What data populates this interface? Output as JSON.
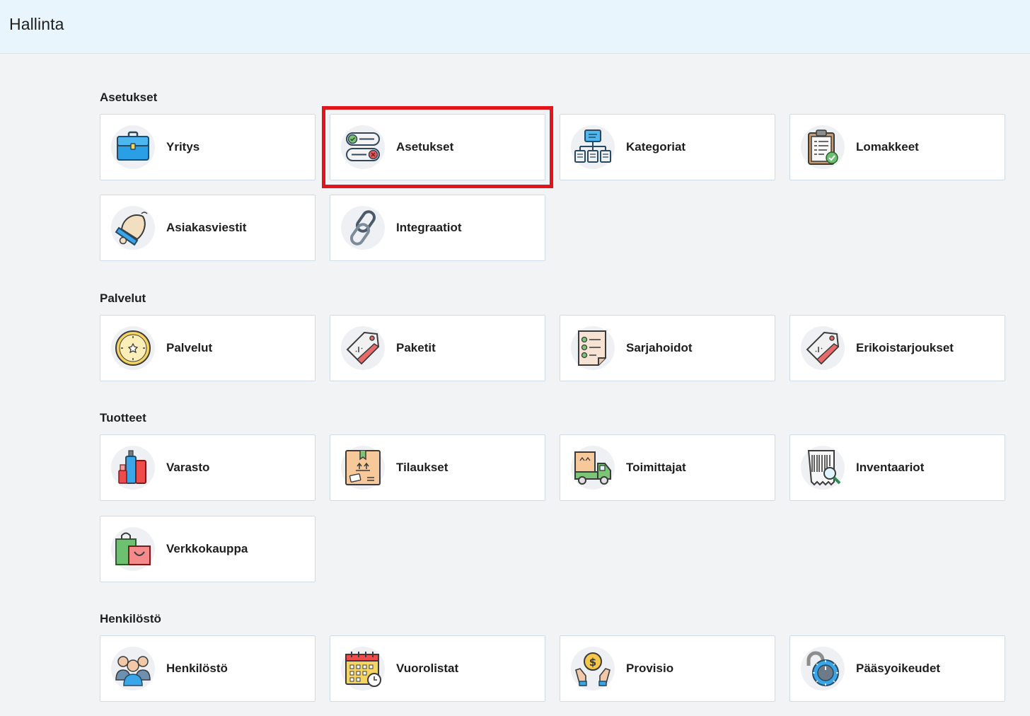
{
  "header": {
    "title": "Hallinta"
  },
  "sections": [
    {
      "title": "Asetukset",
      "items": [
        {
          "label": "Yritys",
          "icon": "briefcase-icon"
        },
        {
          "label": "Asetukset",
          "icon": "toggle-settings-icon"
        },
        {
          "label": "Kategoriat",
          "icon": "hierarchy-icon"
        },
        {
          "label": "Lomakkeet",
          "icon": "clipboard-check-icon"
        },
        {
          "label": "Asiakasviestit",
          "icon": "bell-icon"
        },
        {
          "label": "Integraatiot",
          "icon": "chain-link-icon"
        }
      ]
    },
    {
      "title": "Palvelut",
      "items": [
        {
          "label": "Palvelut",
          "icon": "clock-flower-icon"
        },
        {
          "label": "Paketit",
          "icon": "price-tag-icon"
        },
        {
          "label": "Sarjahoidot",
          "icon": "checklist-icon"
        },
        {
          "label": "Erikoistarjoukset",
          "icon": "discount-tag-icon"
        }
      ]
    },
    {
      "title": "Tuotteet",
      "items": [
        {
          "label": "Varasto",
          "icon": "cosmetics-icon"
        },
        {
          "label": "Tilaukset",
          "icon": "package-box-icon"
        },
        {
          "label": "Toimittajat",
          "icon": "delivery-truck-icon"
        },
        {
          "label": "Inventaariot",
          "icon": "barcode-search-icon"
        },
        {
          "label": "Verkkokauppa",
          "icon": "shopping-bags-icon"
        }
      ]
    },
    {
      "title": "Henkilöstö",
      "items": [
        {
          "label": "Henkilöstö",
          "icon": "team-icon"
        },
        {
          "label": "Vuorolistat",
          "icon": "calendar-clock-icon"
        },
        {
          "label": "Provisio",
          "icon": "hands-coin-icon"
        },
        {
          "label": "Pääsyoikeudet",
          "icon": "combination-lock-icon"
        }
      ]
    }
  ],
  "highlight": {
    "target": "Asetukset",
    "color": "#e2141c"
  }
}
